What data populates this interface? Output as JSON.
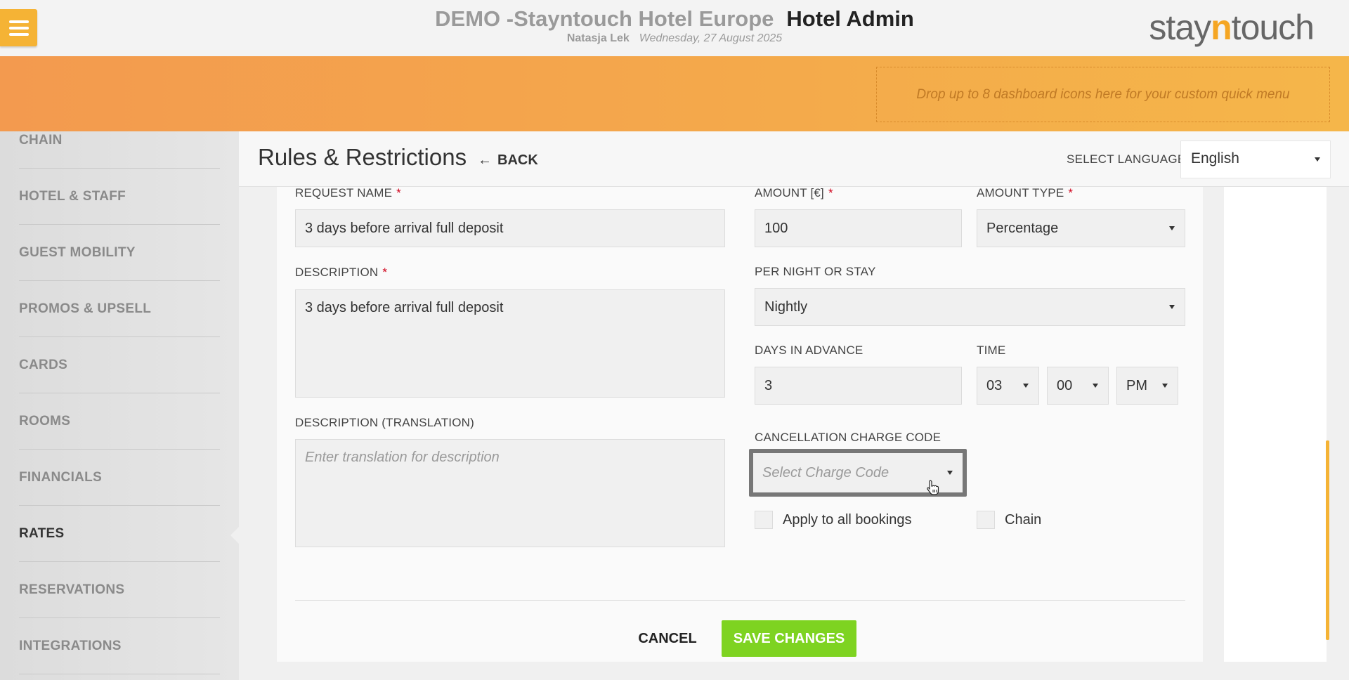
{
  "header": {
    "hotel_name": "DEMO -Stayntouch Hotel Europe",
    "app_name": "Hotel Admin",
    "user_name": "Natasja Lek",
    "date": "Wednesday, 27 August 2025",
    "logo_prefix": "stay",
    "logo_n": "n",
    "logo_suffix": "touch"
  },
  "quickmenu": {
    "dropzone_text": "Drop up to 8 dashboard icons here for your custom quick menu"
  },
  "sidebar": {
    "items": [
      {
        "label": "CHAIN"
      },
      {
        "label": "HOTEL & STAFF"
      },
      {
        "label": "GUEST MOBILITY"
      },
      {
        "label": "PROMOS & UPSELL"
      },
      {
        "label": "CARDS"
      },
      {
        "label": "ROOMS"
      },
      {
        "label": "FINANCIALS"
      },
      {
        "label": "RATES",
        "active": true
      },
      {
        "label": "RESERVATIONS"
      },
      {
        "label": "INTEGRATIONS"
      }
    ]
  },
  "page": {
    "title": "Rules & Restrictions",
    "back_label": "BACK",
    "language_label": "SELECT LANGUAGE",
    "language_value": "English"
  },
  "form": {
    "request_name": {
      "label": "REQUEST NAME",
      "required": "*",
      "value": "3 days before arrival full deposit"
    },
    "description": {
      "label": "DESCRIPTION",
      "required": "*",
      "value": "3 days before arrival full deposit"
    },
    "description_translation": {
      "label": "DESCRIPTION (TRANSLATION)",
      "placeholder": "Enter translation for description"
    },
    "amount": {
      "label": "AMOUNT [€]",
      "required": "*",
      "value": "100"
    },
    "amount_type": {
      "label": "AMOUNT TYPE",
      "required": "*",
      "value": "Percentage"
    },
    "per_night_or_stay": {
      "label": "PER NIGHT OR STAY",
      "value": "Nightly"
    },
    "days_in_advance": {
      "label": "DAYS IN ADVANCE",
      "value": "3"
    },
    "time": {
      "label": "TIME",
      "hour": "03",
      "minute": "00",
      "ampm": "PM"
    },
    "cancellation_charge_code": {
      "label": "CANCELLATION CHARGE CODE",
      "placeholder": "Select Charge Code"
    },
    "apply_all_bookings": {
      "label": "Apply to all bookings",
      "checked": false
    },
    "chain": {
      "label": "Chain",
      "checked": false
    }
  },
  "actions": {
    "cancel_label": "CANCEL",
    "save_label": "SAVE CHANGES"
  },
  "icons": {
    "menu": "hamburger-icon",
    "back": "left-arrow-icon",
    "caret": "caret-down-icon",
    "cursor": "hand-pointer-icon"
  },
  "colors": {
    "accent": "#f5b335",
    "orange_bar_start": "#f39a4f",
    "orange_bar_end": "#f5b64a",
    "save_button": "#7ed321",
    "required": "#d0021b"
  }
}
